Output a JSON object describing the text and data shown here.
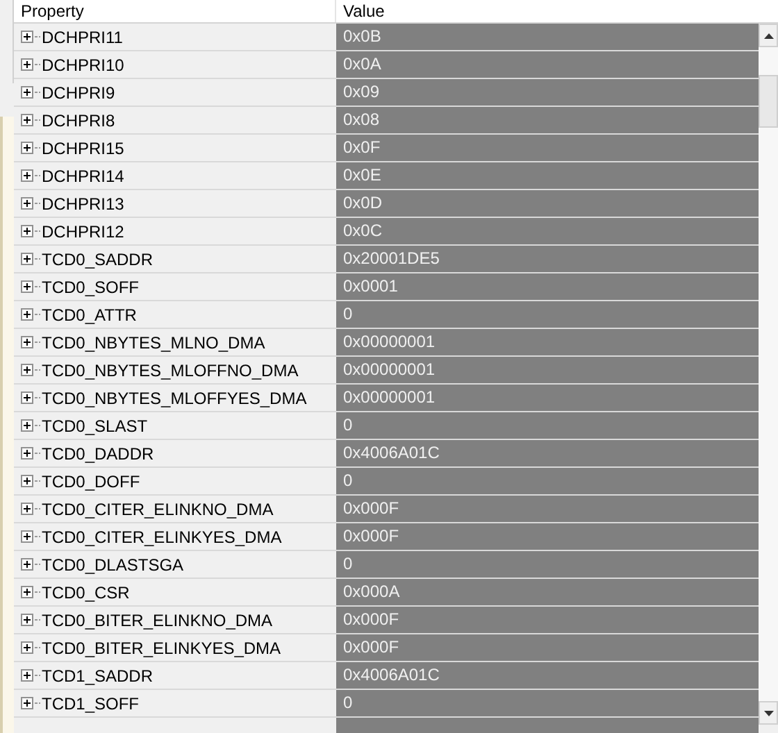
{
  "columns": [
    "Property",
    "Value"
  ],
  "rows": [
    {
      "property": "DCHPRI11",
      "value": "0x0B",
      "expanded": false
    },
    {
      "property": "DCHPRI10",
      "value": "0x0A",
      "expanded": false
    },
    {
      "property": "DCHPRI9",
      "value": "0x09",
      "expanded": false
    },
    {
      "property": "DCHPRI8",
      "value": "0x08",
      "expanded": false
    },
    {
      "property": "DCHPRI15",
      "value": "0x0F",
      "expanded": false
    },
    {
      "property": "DCHPRI14",
      "value": "0x0E",
      "expanded": false
    },
    {
      "property": "DCHPRI13",
      "value": "0x0D",
      "expanded": false
    },
    {
      "property": "DCHPRI12",
      "value": "0x0C",
      "expanded": false
    },
    {
      "property": "TCD0_SADDR",
      "value": "0x20001DE5",
      "expanded": false
    },
    {
      "property": "TCD0_SOFF",
      "value": "0x0001",
      "expanded": false
    },
    {
      "property": "TCD0_ATTR",
      "value": "0",
      "expanded": false
    },
    {
      "property": "TCD0_NBYTES_MLNO_DMA",
      "value": "0x00000001",
      "expanded": false
    },
    {
      "property": "TCD0_NBYTES_MLOFFNO_DMA",
      "value": "0x00000001",
      "expanded": false
    },
    {
      "property": "TCD0_NBYTES_MLOFFYES_DMA",
      "value": "0x00000001",
      "expanded": false
    },
    {
      "property": "TCD0_SLAST",
      "value": "0",
      "expanded": false
    },
    {
      "property": "TCD0_DADDR",
      "value": "0x4006A01C",
      "expanded": false
    },
    {
      "property": "TCD0_DOFF",
      "value": "0",
      "expanded": false
    },
    {
      "property": "TCD0_CITER_ELINKNO_DMA",
      "value": "0x000F",
      "expanded": false
    },
    {
      "property": "TCD0_CITER_ELINKYES_DMA",
      "value": "0x000F",
      "expanded": false
    },
    {
      "property": "TCD0_DLASTSGA",
      "value": "0",
      "expanded": false
    },
    {
      "property": "TCD0_CSR",
      "value": "0x000A",
      "expanded": false
    },
    {
      "property": "TCD0_BITER_ELINKNO_DMA",
      "value": "0x000F",
      "expanded": false
    },
    {
      "property": "TCD0_BITER_ELINKYES_DMA",
      "value": "0x000F",
      "expanded": false
    },
    {
      "property": "TCD1_SADDR",
      "value": "0x4006A01C",
      "expanded": false
    },
    {
      "property": "TCD1_SOFF",
      "value": "0",
      "expanded": false
    }
  ]
}
